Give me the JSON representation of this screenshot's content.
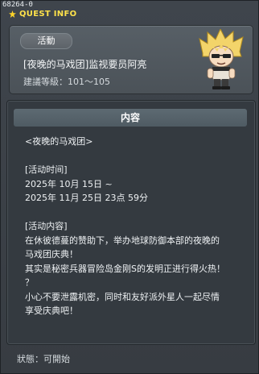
{
  "window": {
    "id": "68264-0",
    "title": "QUEST INFO"
  },
  "header": {
    "badge": "活動",
    "quest_name": "[夜晚的马戏团]监视要员阿亮",
    "level_requirement": "建議等級：101～105"
  },
  "content": {
    "heading": "内容",
    "lines": [
      "<夜晚的马戏团>",
      "",
      "[活动时间]",
      "2025年 10月 15日 ~",
      "2025年 11月 25日 23点 59分",
      "",
      "[活动内容]",
      "在休彼德蔓的赞助下，举办地球防御本部的夜晚的",
      "马戏团庆典！",
      "其实是秘密兵器冒险岛金刚S的发明正进行得火热！",
      "？",
      "小心不要泄露机密，同时和友好派外星人一起尽情",
      "享受庆典吧！"
    ]
  },
  "status": {
    "text": "狀態：可開始"
  },
  "colors": {
    "title": "#ffe24a",
    "star": "#ffd429",
    "panel": "#343a40",
    "header_bar": "#56636b"
  },
  "icons": {
    "title_icon": "star-icon",
    "npc": "npc-portrait"
  }
}
